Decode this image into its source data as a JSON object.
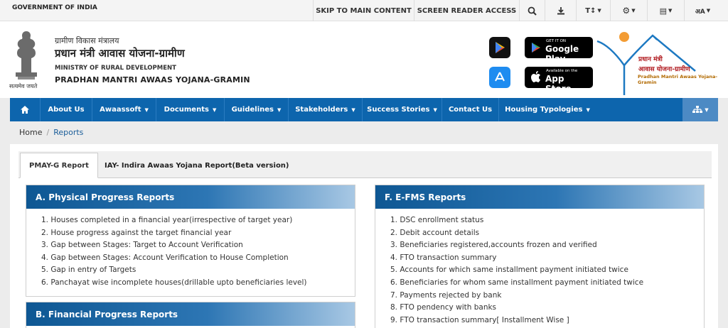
{
  "topbar": {
    "government": "GOVERNMENT OF INDIA",
    "skip": "SKIP TO MAIN CONTENT",
    "screen_reader": "SCREEN READER ACCESS",
    "text_size": "T↕",
    "lang": "अA"
  },
  "header": {
    "emblem_caption": "सत्यमेव जयते",
    "hindi_ministry": "ग्रामीण विकास मंत्रालय",
    "hindi_scheme": "प्रधान मंत्री आवास योजना-ग्रामीण",
    "ministry": "MINISTRY OF RURAL DEVELOPMENT",
    "scheme": "PRADHAN MANTRI AWAAS YOJANA-GRAMIN",
    "google_small": "GET IT ON",
    "google_big": "Google Play",
    "apple_small": "Available on the",
    "apple_big": "App Store",
    "logo_hindi1": "प्रधान मंत्री",
    "logo_hindi2": "आवास योजना-ग्रामीण",
    "logo_english": "Pradhan Mantri Awaas Yojana-Gramin"
  },
  "nav": {
    "items": [
      {
        "label": "About Us"
      },
      {
        "label": "Awaassoft"
      },
      {
        "label": "Documents"
      },
      {
        "label": "Guidelines"
      },
      {
        "label": "Stakeholders"
      },
      {
        "label": "Success Stories"
      },
      {
        "label": "Contact Us"
      },
      {
        "label": "Housing Typologies"
      }
    ]
  },
  "breadcrumb": {
    "home": "Home",
    "current": "Reports"
  },
  "tabs": [
    {
      "label": "PMAY-G Report"
    },
    {
      "label": "IAY- Indira Awaas Yojana Report(Beta version)"
    }
  ],
  "panels": {
    "physical": {
      "title": "A. Physical Progress Reports",
      "items": [
        "1. Houses completed in a financial year(irrespective of target year)",
        "2. House progress against the target financial year",
        "3. Gap between Stages: Target to Account Verification",
        "4. Gap between Stages: Account Verification to House Completion",
        "5. Gap in entry of Targets",
        "6. Panchayat wise incomplete houses(drillable upto beneficiaries level)"
      ]
    },
    "financial": {
      "title": "B. Financial Progress Reports"
    },
    "efms": {
      "title": "F. E-FMS Reports",
      "items": [
        "1. DSC enrollment status",
        "2. Debit account details",
        "3. Beneficiaries registered,accounts frozen and verified",
        "4. FTO transaction summary",
        "5. Accounts for which same installment payment initiated twice",
        "6. Beneficiaries for whom same installment payment initiated twice",
        "7. Payments rejected by bank",
        "8. FTO pendency with banks",
        "9. FTO transaction summary[ Installment Wise ]"
      ]
    }
  }
}
